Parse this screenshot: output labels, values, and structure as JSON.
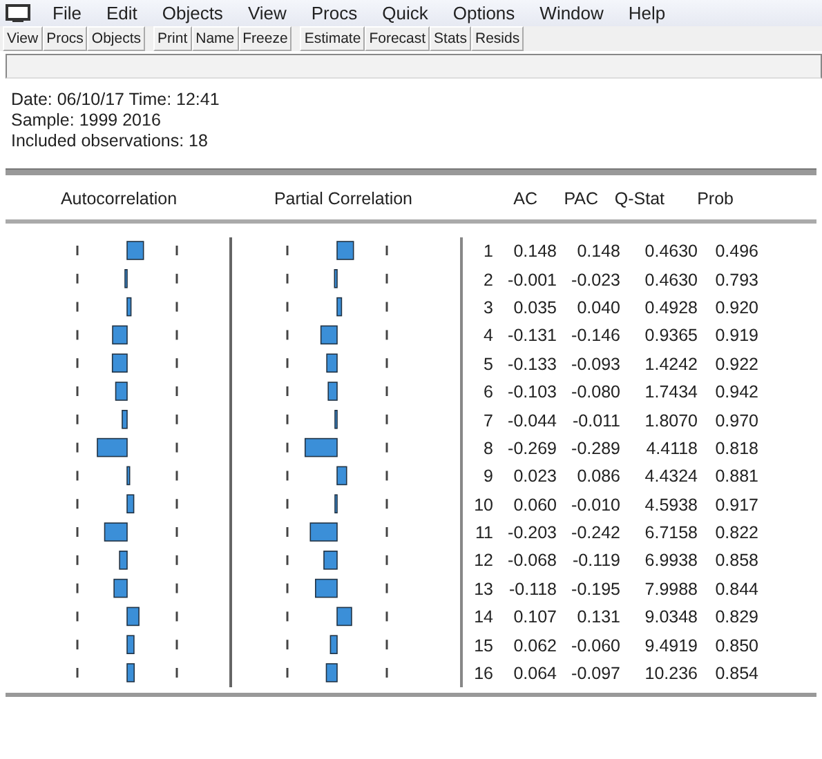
{
  "menu": [
    "File",
    "Edit",
    "Objects",
    "View",
    "Procs",
    "Quick",
    "Options",
    "Window",
    "Help"
  ],
  "toolbar": [
    [
      "View",
      "Procs",
      "Objects"
    ],
    [
      "Print",
      "Name",
      "Freeze"
    ],
    [
      "Estimate",
      "Forecast",
      "Stats",
      "Resids"
    ]
  ],
  "info": [
    "Date: 06/10/17   Time: 12:41",
    "Sample: 1999 2016",
    "Included observations: 18"
  ],
  "table": {
    "columns": [
      "Autocorrelation",
      "Partial Correlation",
      "AC",
      "PAC",
      "Q-Stat",
      "Prob"
    ],
    "rows": [
      {
        "lag": "1",
        "ac": "0.148",
        "pac": "0.148",
        "q": "0.4630",
        "prob": "0.496"
      },
      {
        "lag": "2",
        "ac": "-0.001",
        "pac": "-0.023",
        "q": "0.4630",
        "prob": "0.793"
      },
      {
        "lag": "3",
        "ac": "0.035",
        "pac": "0.040",
        "q": "0.4928",
        "prob": "0.920"
      },
      {
        "lag": "4",
        "ac": "-0.131",
        "pac": "-0.146",
        "q": "0.9365",
        "prob": "0.919"
      },
      {
        "lag": "5",
        "ac": "-0.133",
        "pac": "-0.093",
        "q": "1.4242",
        "prob": "0.922"
      },
      {
        "lag": "6",
        "ac": "-0.103",
        "pac": "-0.080",
        "q": "1.7434",
        "prob": "0.942"
      },
      {
        "lag": "7",
        "ac": "-0.044",
        "pac": "-0.011",
        "q": "1.8070",
        "prob": "0.970"
      },
      {
        "lag": "8",
        "ac": "-0.269",
        "pac": "-0.289",
        "q": "4.4118",
        "prob": "0.818"
      },
      {
        "lag": "9",
        "ac": "0.023",
        "pac": "0.086",
        "q": "4.4324",
        "prob": "0.881"
      },
      {
        "lag": "10",
        "ac": "0.060",
        "pac": "-0.010",
        "q": "4.5938",
        "prob": "0.917"
      },
      {
        "lag": "11",
        "ac": "-0.203",
        "pac": "-0.242",
        "q": "6.7158",
        "prob": "0.822"
      },
      {
        "lag": "12",
        "ac": "-0.068",
        "pac": "-0.119",
        "q": "6.9938",
        "prob": "0.858"
      },
      {
        "lag": "13",
        "ac": "-0.118",
        "pac": "-0.195",
        "q": "7.9988",
        "prob": "0.844"
      },
      {
        "lag": "14",
        "ac": "0.107",
        "pac": "0.131",
        "q": "9.0348",
        "prob": "0.829"
      },
      {
        "lag": "15",
        "ac": "0.062",
        "pac": "-0.060",
        "q": "9.4919",
        "prob": "0.850"
      },
      {
        "lag": "16",
        "ac": "0.064",
        "pac": "-0.097",
        "q": "10.236",
        "prob": "0.854"
      }
    ]
  }
}
